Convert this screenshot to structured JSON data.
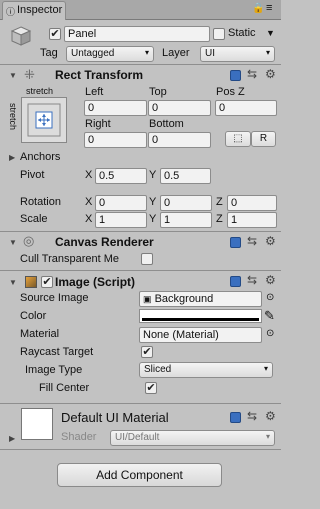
{
  "tab": {
    "label": "Inspector"
  },
  "object": {
    "name": "Panel",
    "static_label": "Static",
    "tag_label": "Tag",
    "tag_value": "Untagged",
    "layer_label": "Layer",
    "layer_value": "UI",
    "active": true
  },
  "rect_transform": {
    "title": "Rect Transform",
    "anchor_preset_top": "stretch",
    "anchor_preset_side": "stretch",
    "left_label": "Left",
    "top_label": "Top",
    "posz_label": "Pos Z",
    "left_value": "0",
    "top_value": "0",
    "posz_value": "0",
    "right_label": "Right",
    "bottom_label": "Bottom",
    "right_value": "0",
    "bottom_value": "0",
    "r_button": "R",
    "anchors_label": "Anchors",
    "pivot_label": "Pivot",
    "pivot_x_label": "X",
    "pivot_x": "0.5",
    "pivot_y_label": "Y",
    "pivot_y": "0.5",
    "rotation_label": "Rotation",
    "rot_x_label": "X",
    "rot_x": "0",
    "rot_y_label": "Y",
    "rot_y": "0",
    "rot_z_label": "Z",
    "rot_z": "0",
    "scale_label": "Scale",
    "scale_x_label": "X",
    "scale_x": "1",
    "scale_y_label": "Y",
    "scale_y": "1",
    "scale_z_label": "Z",
    "scale_z": "1"
  },
  "canvas_renderer": {
    "title": "Canvas Renderer",
    "cull_label": "Cull Transparent Me",
    "cull_checked": false
  },
  "image": {
    "title": "Image (Script)",
    "source_label": "Source Image",
    "source_value": "Background",
    "color_label": "Color",
    "material_label": "Material",
    "material_value": "None (Material)",
    "raycast_label": "Raycast Target",
    "raycast_checked": true,
    "type_label": "Image Type",
    "type_value": "Sliced",
    "fill_label": "Fill Center",
    "fill_checked": true
  },
  "material": {
    "title": "Default UI Material",
    "shader_label": "Shader",
    "shader_value": "UI/Default"
  },
  "add_component": {
    "label": "Add Component"
  },
  "colors": {
    "panel_bg": "#c2c2c2",
    "header_bg": "#a8a8a8",
    "accent_blue": "#3a6fbf"
  },
  "icons": [
    "lock-icon",
    "menu-icon",
    "cube-icon",
    "rect-transform-icon",
    "canvas-renderer-icon",
    "image-icon",
    "help-icon",
    "settings-icon",
    "gear-icon",
    "eyedropper-icon",
    "object-picker-icon"
  ]
}
